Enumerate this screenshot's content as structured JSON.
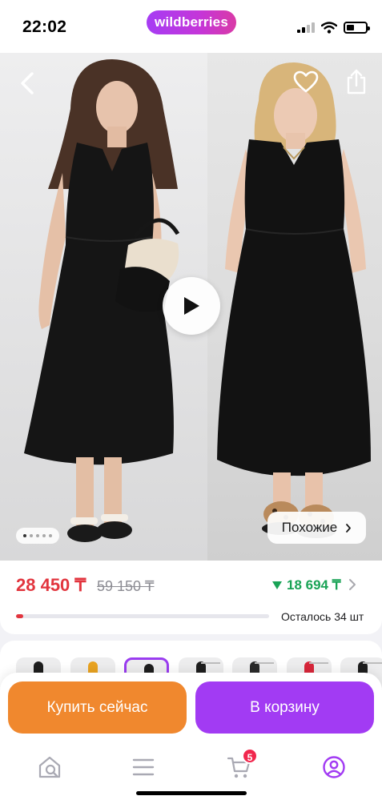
{
  "status_bar": {
    "time": "22:02",
    "brand": "wildberries",
    "icons": [
      "signal-icon",
      "wifi-icon",
      "battery-icon"
    ]
  },
  "gallery": {
    "actions": {
      "back_icon": "chevron-left-icon",
      "favorite_icon": "heart-icon",
      "share_icon": "share-icon",
      "play_icon": "play-icon"
    },
    "dots_count": 5,
    "active_dot": 0,
    "similar_label": "Похожие",
    "similar_icon": "chevron-right-icon"
  },
  "price": {
    "current": "28 450 ₸",
    "old": "59 150 ₸",
    "delta": "18 694 ₸",
    "delta_icon": "triangle-down-icon",
    "stock_label": "Осталось 34 шт",
    "stock_fill_fraction": 0.03
  },
  "thumbnails": {
    "count": 7,
    "selected_index": 2
  },
  "actions": {
    "buy_label": "Купить сейчас",
    "cart_label": "В корзину"
  },
  "tabbar": {
    "items": [
      {
        "icon": "home-search-icon"
      },
      {
        "icon": "menu-icon"
      },
      {
        "icon": "cart-icon",
        "badge": "5"
      },
      {
        "icon": "profile-icon"
      }
    ]
  },
  "colors": {
    "accent": "#a23bf3",
    "buy": "#f0882e",
    "price": "#e2353e",
    "delta": "#1aa356"
  }
}
